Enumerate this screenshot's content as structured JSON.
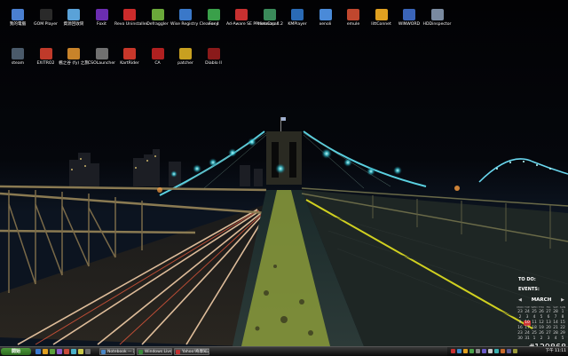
{
  "desktop": {
    "icons_row1": [
      {
        "label": "我的電腦",
        "icon": "computer-icon",
        "color": "#4a7fd0"
      },
      {
        "label": "GOM Player",
        "icon": "gom-icon",
        "color": "#2a2a2a"
      },
      {
        "label": "資源回收筒",
        "icon": "recycle-bin-icon",
        "color": "#5aa2d8"
      },
      {
        "label": "Foxit",
        "icon": "foxit-icon",
        "color": "#6b2db0"
      },
      {
        "label": "Revo Uninstaller",
        "icon": "revo-icon",
        "color": "#cc2b2b"
      },
      {
        "label": "Defraggler",
        "icon": "defraggler-icon",
        "color": "#6aa83a"
      },
      {
        "label": "Wise Registry Cleaner 4",
        "icon": "wise-icon",
        "color": "#3a78c9"
      },
      {
        "label": "Foxy",
        "icon": "foxy-icon",
        "color": "#3aa04a"
      },
      {
        "label": "Ad-Aware SE Professional",
        "icon": "adaware-icon",
        "color": "#c73030"
      },
      {
        "label": "PhotoCap 4.2",
        "icon": "photocap-icon",
        "color": "#3a8a5a"
      },
      {
        "label": "KMPlayer",
        "icon": "kmplayer-icon",
        "color": "#2a6ab5"
      },
      {
        "label": "xenoli",
        "icon": "xenoli-icon",
        "color": "#4a8ad8"
      },
      {
        "label": "emule",
        "icon": "emule-icon",
        "color": "#c0472e"
      },
      {
        "label": "littConnet",
        "icon": "littconnet-icon",
        "color": "#e0a020"
      },
      {
        "label": "WINWORD",
        "icon": "winword-icon",
        "color": "#3a64b8"
      },
      {
        "label": "HDDinspector",
        "icon": "hddinspector-icon",
        "color": "#7a8aa0"
      }
    ],
    "icons_row2": [
      {
        "label": "steam",
        "icon": "steam-icon",
        "color": "#4a5a6a"
      },
      {
        "label": "EXITRO2",
        "icon": "exitro2-icon",
        "color": "#c03a2a"
      },
      {
        "label": "楓之谷 (fy) 之旅",
        "icon": "game-icon",
        "color": "#c8832a"
      },
      {
        "label": "CSOLauncher",
        "icon": "cso-icon",
        "color": "#707070"
      },
      {
        "label": "KartRider",
        "icon": "kartrider-icon",
        "color": "#c8372a"
      },
      {
        "label": "CA",
        "icon": "ca-icon",
        "color": "#b02020"
      },
      {
        "label": "patcher",
        "icon": "patcher-icon",
        "color": "#c8a020"
      },
      {
        "label": "Diablo II",
        "icon": "diablo-icon",
        "color": "#8a1a1a"
      }
    ]
  },
  "widget": {
    "todo_label": "TO DO:",
    "events_label": "EVENTS:",
    "month": "MARCH",
    "weekday_headers": [
      "MON",
      "TUE",
      "WED",
      "THU",
      "FRI",
      "SAT",
      "SUN"
    ],
    "weeks": [
      [
        "23",
        "24",
        "25",
        "26",
        "27",
        "28",
        "1"
      ],
      [
        "2",
        "3",
        "4",
        "5",
        "6",
        "7",
        "8"
      ],
      [
        "9",
        "10",
        "11",
        "12",
        "13",
        "14",
        "15"
      ],
      [
        "16",
        "17",
        "18",
        "19",
        "20",
        "21",
        "22"
      ],
      [
        "23",
        "24",
        "25",
        "26",
        "27",
        "28",
        "29"
      ],
      [
        "30",
        "31",
        "1",
        "2",
        "3",
        "4",
        "5"
      ]
    ],
    "today": "10"
  },
  "watermark": "#129868",
  "taskbar": {
    "start_label": "開始",
    "tasks": [
      {
        "label": "Notebook — 記事本",
        "icon_color": "#4a88c8"
      },
      {
        "label": "Windows Live M...",
        "icon_color": "#3a8a3a"
      },
      {
        "label": "Yahoo!奇摩知識+",
        "icon_color": "#c03030"
      }
    ],
    "clock": "下午 11:11"
  }
}
